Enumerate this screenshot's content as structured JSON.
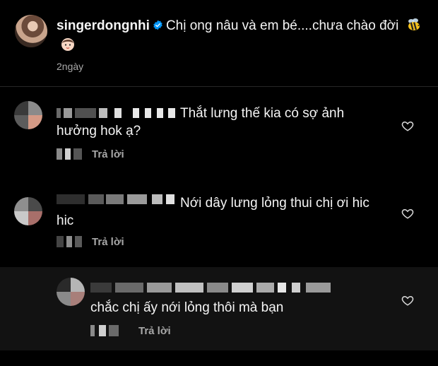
{
  "caption": {
    "username": "singerdongnhi",
    "text": "Chị ong nâu và em bé....chưa chào đời",
    "time": "2ngày",
    "emojis": [
      "bee-emoji",
      "baby-emoji"
    ]
  },
  "comments": [
    {
      "text": "Thắt lưng thế kia có sợ ảnh hưởng hok ạ?",
      "reply_label": "Trả lời"
    },
    {
      "text": "Nới dây lưng lỏng thui chị ơi hic hic",
      "reply_label": "Trả lời"
    },
    {
      "text": "chắc chị ấy nới lỏng thôi mà bạn",
      "reply_label": "Trả lời"
    }
  ],
  "colors": {
    "background": "#000000",
    "reply_background": "#121212",
    "text": "#f5f5f5",
    "secondary_text": "#a8a8a8",
    "verified_blue": "#0095f6"
  }
}
